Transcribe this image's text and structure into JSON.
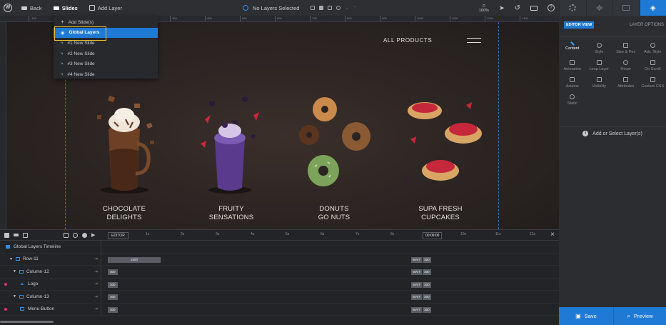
{
  "toolbar": {
    "back_label": "Back",
    "slides_label": "Slides",
    "add_layer_label": "Add Layer",
    "layer_status": "No Layers Selected",
    "zoom": "100%"
  },
  "dropdown": {
    "items": [
      {
        "label": "Add Slide(s)"
      },
      {
        "label": "Global Layers"
      },
      {
        "label": "#1 New Slide"
      },
      {
        "label": "#2 New Slide"
      },
      {
        "label": "#3 New Slide"
      },
      {
        "label": "#4 New Slide"
      }
    ]
  },
  "ruler": {
    "ticks": [
      "-100",
      "0",
      "100",
      "200",
      "300",
      "400",
      "500",
      "600",
      "700",
      "800",
      "900",
      "1000",
      "1100",
      "1200",
      "1300"
    ]
  },
  "canvas": {
    "nav_link": "ALL PRODUCTS",
    "products": [
      {
        "line1": "CHOCOLATE",
        "line2": "DELIGHTS"
      },
      {
        "line1": "FRUITY",
        "line2": "SENSATIONS"
      },
      {
        "line1": "DONUTS",
        "line2": "GO NUTS"
      },
      {
        "line1": "SUPA FRESH",
        "line2": "CUPCAKES"
      }
    ]
  },
  "timeline": {
    "editor_badge": "EDITOR",
    "time_marks": [
      "1s",
      "2s",
      "3s",
      "4s",
      "5s",
      "6s",
      "7s",
      "8s",
      "10s",
      "11s",
      "12s"
    ],
    "current_time": "00:09:00",
    "title": "Global Layers Timeline",
    "rows": [
      {
        "name": "Row-11",
        "bar": "1500",
        "wait": "WAIT",
        "wait_val": "300"
      },
      {
        "name": "Column-12",
        "bar": "300",
        "wait": "WAIT",
        "wait_val": "300"
      },
      {
        "name": "Logo",
        "bar": "300",
        "wait": "WAIT",
        "wait_val": "300"
      },
      {
        "name": "Column-13",
        "bar": "300",
        "wait": "WAIT",
        "wait_val": "300"
      },
      {
        "name": "Menu-Button",
        "bar": "300",
        "wait": "WAIT",
        "wait_val": "300"
      }
    ]
  },
  "panel": {
    "editor_view": "EDITOR VIEW",
    "layer_options": "LAYER OPTIONS",
    "tabs": [
      "Content",
      "Style",
      "Size & Pos",
      "Adv. Style",
      "Animation",
      "Loop Layer",
      "Hover",
      "On Scroll",
      "Actions",
      "Visibility",
      "Attributes",
      "Custom CSS",
      "Static"
    ],
    "empty_message": "Add or Select Layer(s)",
    "save_label": "Save",
    "preview_label": "Preview"
  }
}
